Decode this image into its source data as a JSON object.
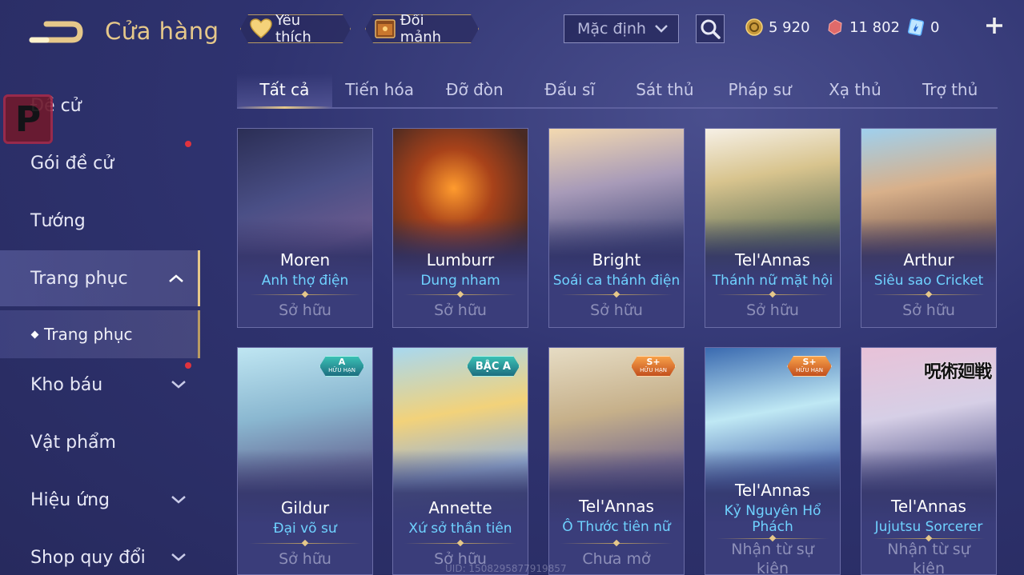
{
  "header": {
    "title": "Cửa hàng",
    "favorites_label": "Yêu thích",
    "shard_exchange_label": "Đổi mảnh",
    "sort_value": "Mặc định",
    "gold": "5 920",
    "vouchers": "11 802",
    "tickets": "0"
  },
  "sidebar": {
    "items": [
      {
        "label": "Đề cử"
      },
      {
        "label": "Gói đề cử"
      },
      {
        "label": "Tướng"
      },
      {
        "label": "Trang phục"
      },
      {
        "label": "Kho báu"
      },
      {
        "label": "Vật phẩm"
      },
      {
        "label": "Hiệu ứng"
      },
      {
        "label": "Shop quy đổi"
      }
    ],
    "sub_item": "Trang phục"
  },
  "tabs": [
    "Tất cả",
    "Tiến hóa",
    "Đỡ đòn",
    "Đấu sĩ",
    "Sát thủ",
    "Pháp sư",
    "Xạ thủ",
    "Trợ thủ"
  ],
  "cards": [
    {
      "hero": "Moren",
      "skin": "Anh thợ điện",
      "status": "Sở hữu"
    },
    {
      "hero": "Lumburr",
      "skin": "Dung nham",
      "status": "Sở hữu"
    },
    {
      "hero": "Bright",
      "skin": "Soái ca thánh điện",
      "status": "Sở hữu"
    },
    {
      "hero": "Tel'Annas",
      "skin": "Thánh nữ mặt hội",
      "status": "Sở hữu"
    },
    {
      "hero": "Arthur",
      "skin": "Siêu sao Cricket",
      "status": "Sở hữu"
    },
    {
      "hero": "Gildur",
      "skin": "Đại võ sư",
      "status": "Sở hữu",
      "badge_top": "A",
      "badge_bottom": "HỮU HẠN"
    },
    {
      "hero": "Annette",
      "skin": "Xứ sở thần tiên",
      "status": "Sở hữu",
      "badge_top": "BẬC A"
    },
    {
      "hero": "Tel'Annas",
      "skin": "Ô Thước tiên nữ",
      "status": "Chưa mở",
      "badge_top": "S+",
      "badge_bottom": "HỮU HẠN"
    },
    {
      "hero": "Tel'Annas",
      "skin": "Kỷ Nguyên Hổ Phách",
      "status": "Nhận từ sự kiện",
      "badge_top": "S+",
      "badge_bottom": "HỮU HẠN"
    },
    {
      "hero": "Tel'Annas",
      "skin": "Jujutsu Sorcerer",
      "status": "Nhận từ sự kiện",
      "badge_top": "呪術廻戦"
    }
  ],
  "uid": "UID: 1508295877919857",
  "colors": {
    "accent_gold": "#e6c88a",
    "skin_name_blue": "#6fd2ff",
    "notification_red": "#e0333e"
  }
}
